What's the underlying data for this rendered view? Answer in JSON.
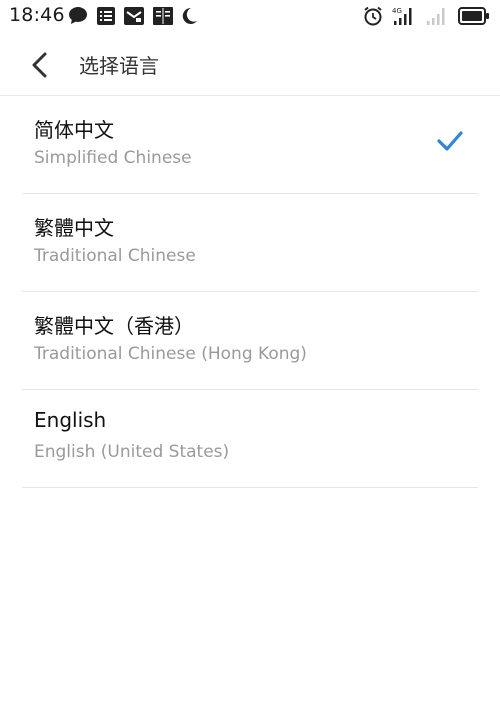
{
  "status_bar": {
    "time": "18:46",
    "left_icons": [
      "message-icon",
      "list-icon",
      "mail-icon",
      "book-icon",
      "moon-icon"
    ],
    "right_icons": [
      "alarm-icon",
      "signal-4g-icon",
      "signal-icon",
      "battery-icon"
    ],
    "network_label": "4G"
  },
  "header": {
    "title": "选择语言"
  },
  "languages": [
    {
      "name": "简体中文",
      "subtitle": "Simplified Chinese",
      "selected": true
    },
    {
      "name": "繁體中文",
      "subtitle": "Traditional Chinese",
      "selected": false
    },
    {
      "name": "繁體中文（香港）",
      "subtitle": "Traditional Chinese (Hong Kong)",
      "selected": false
    },
    {
      "name": "English",
      "subtitle": "English (United States)",
      "selected": false
    }
  ],
  "colors": {
    "accent": "#2f86d6",
    "text_primary": "#111111",
    "text_secondary": "#9a9a9a",
    "divider": "#e6e6e6"
  }
}
